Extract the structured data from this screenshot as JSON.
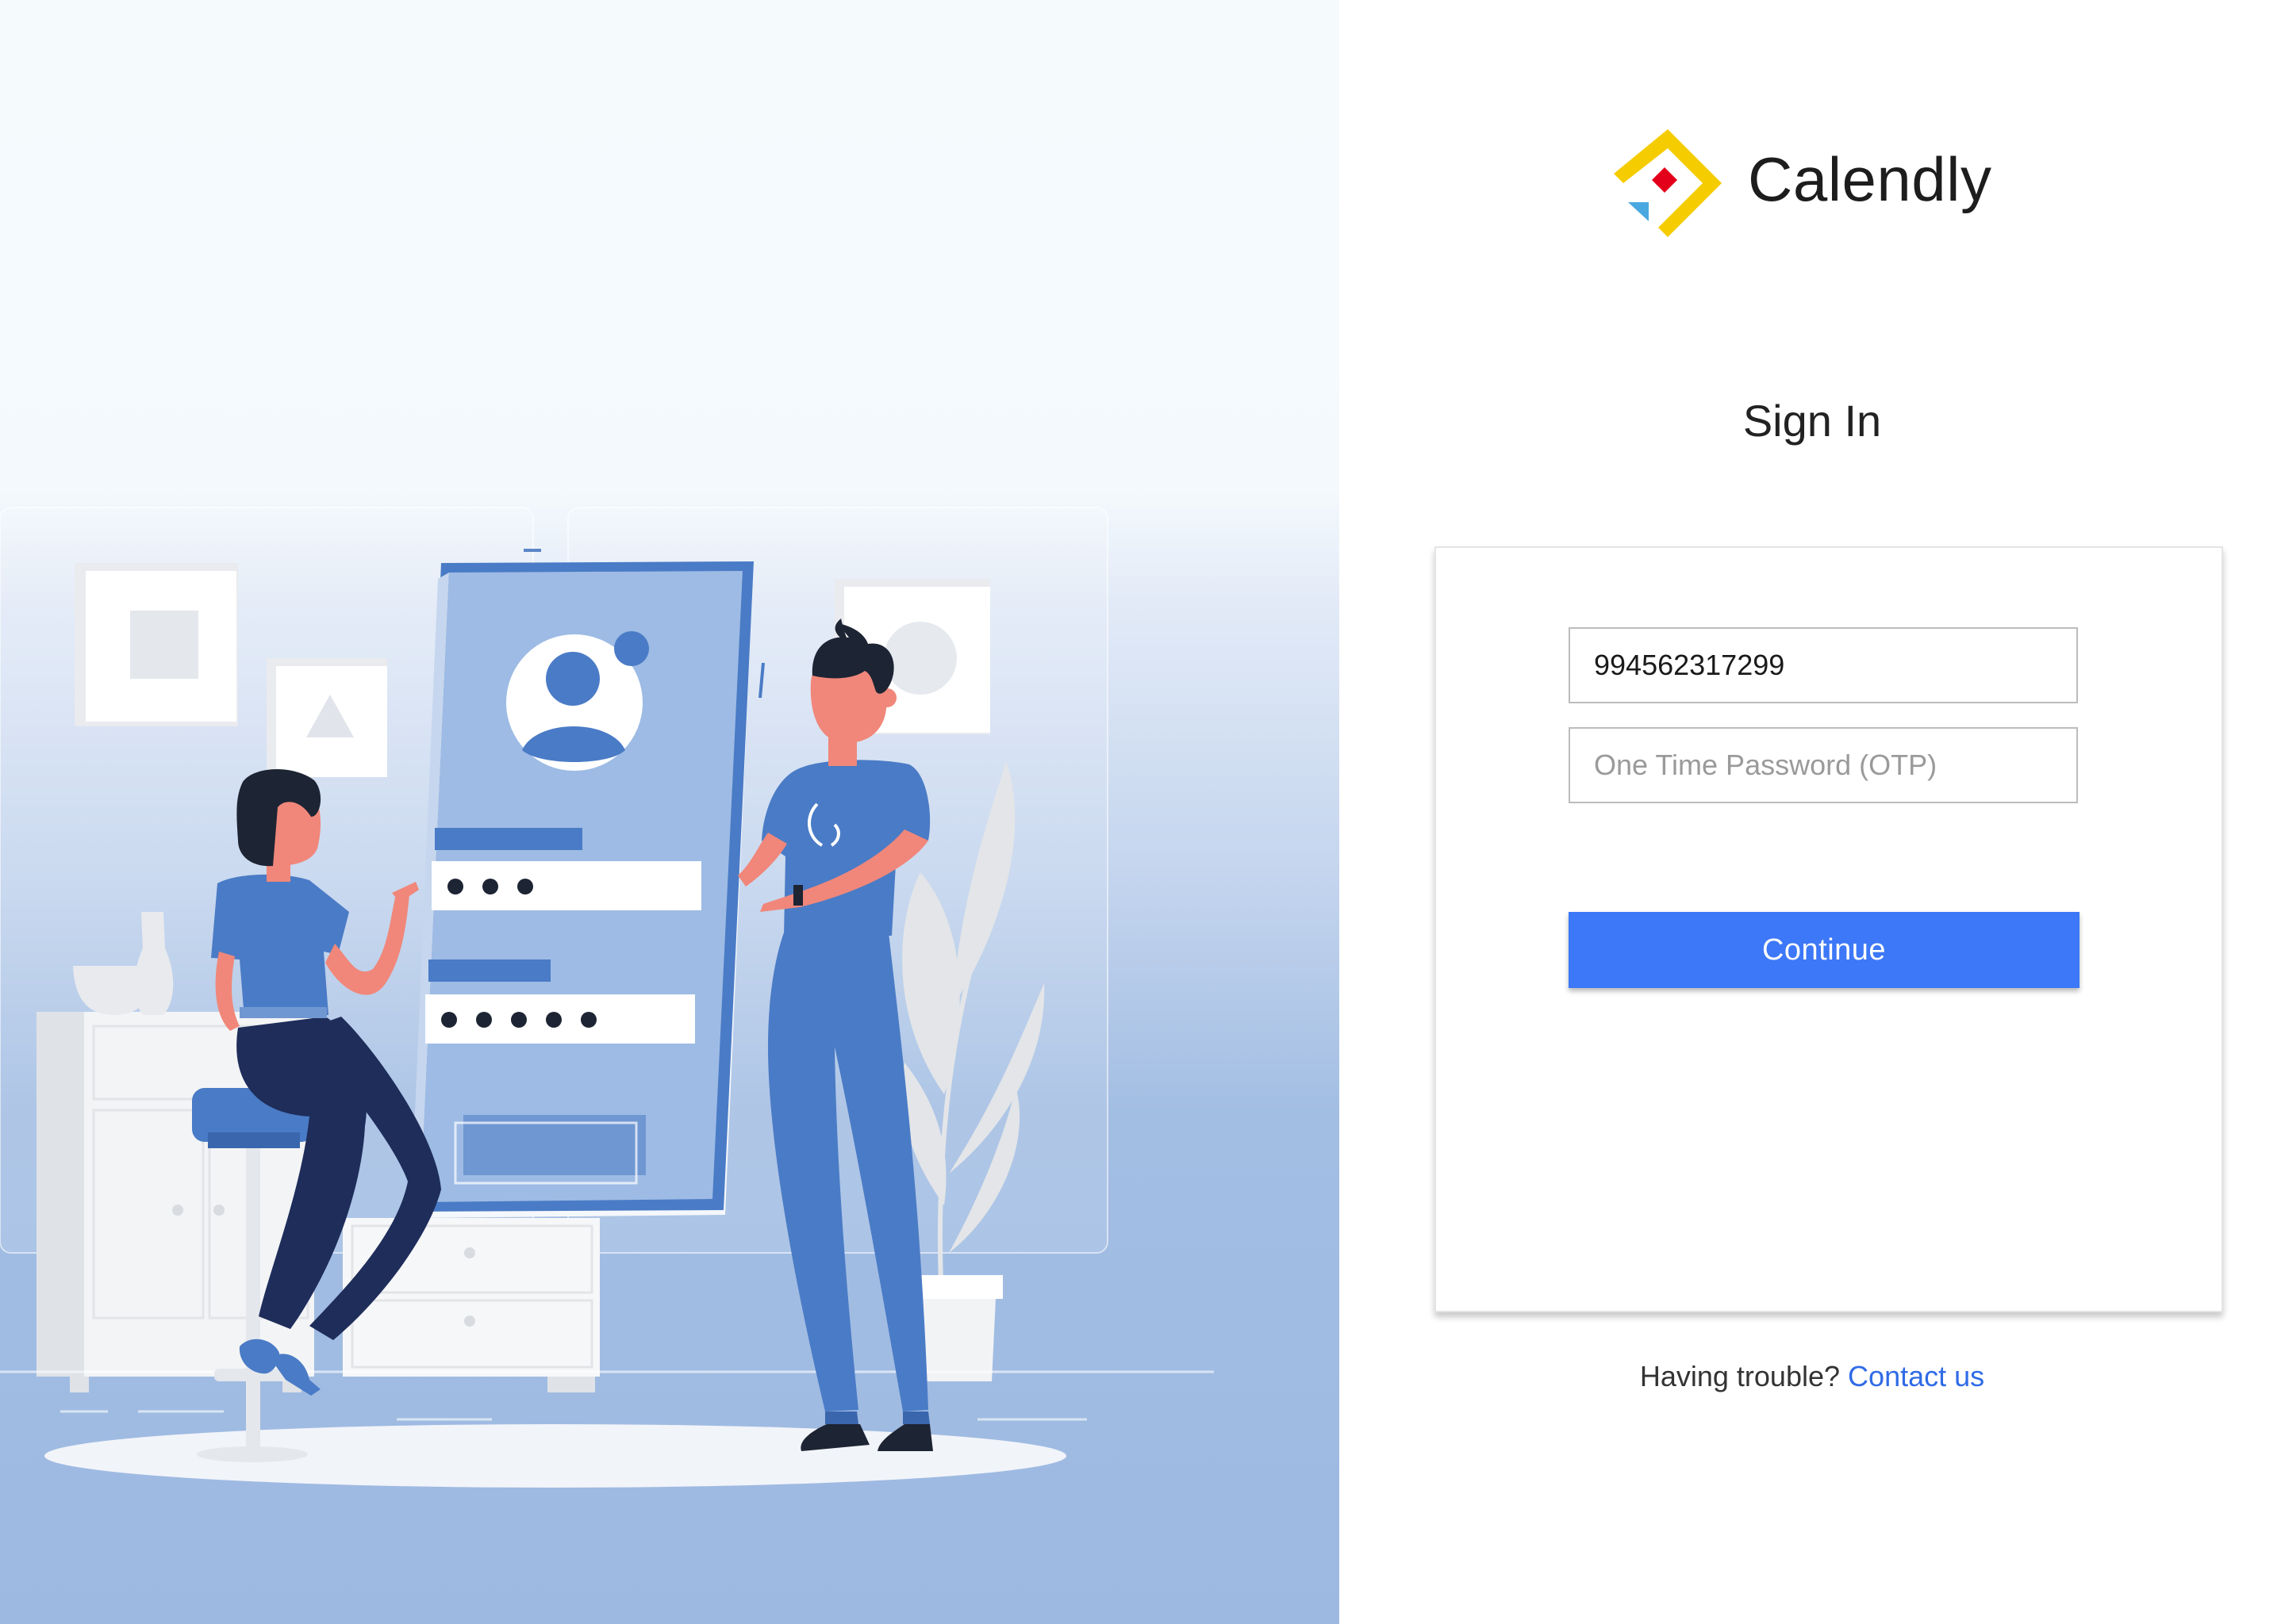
{
  "brand": {
    "name": "Calendly",
    "colors": {
      "yellow": "#f5cc00",
      "red": "#e3001b",
      "blue": "#4aa8e0"
    }
  },
  "signin": {
    "title": "Sign In",
    "phone_value": "994562317299",
    "otp_placeholder": "One Time Password (OTP)",
    "continue_label": "Continue"
  },
  "help": {
    "prompt": "Having trouble?",
    "link_label": "Contact us"
  },
  "colors": {
    "primary_button": "#3c78f7",
    "link": "#2f6be6",
    "illustration_blue": "#4a7bc6"
  },
  "illustration": {
    "icon": "login-illustration",
    "username_mask": "●●●",
    "password_mask": "●●●●●"
  }
}
